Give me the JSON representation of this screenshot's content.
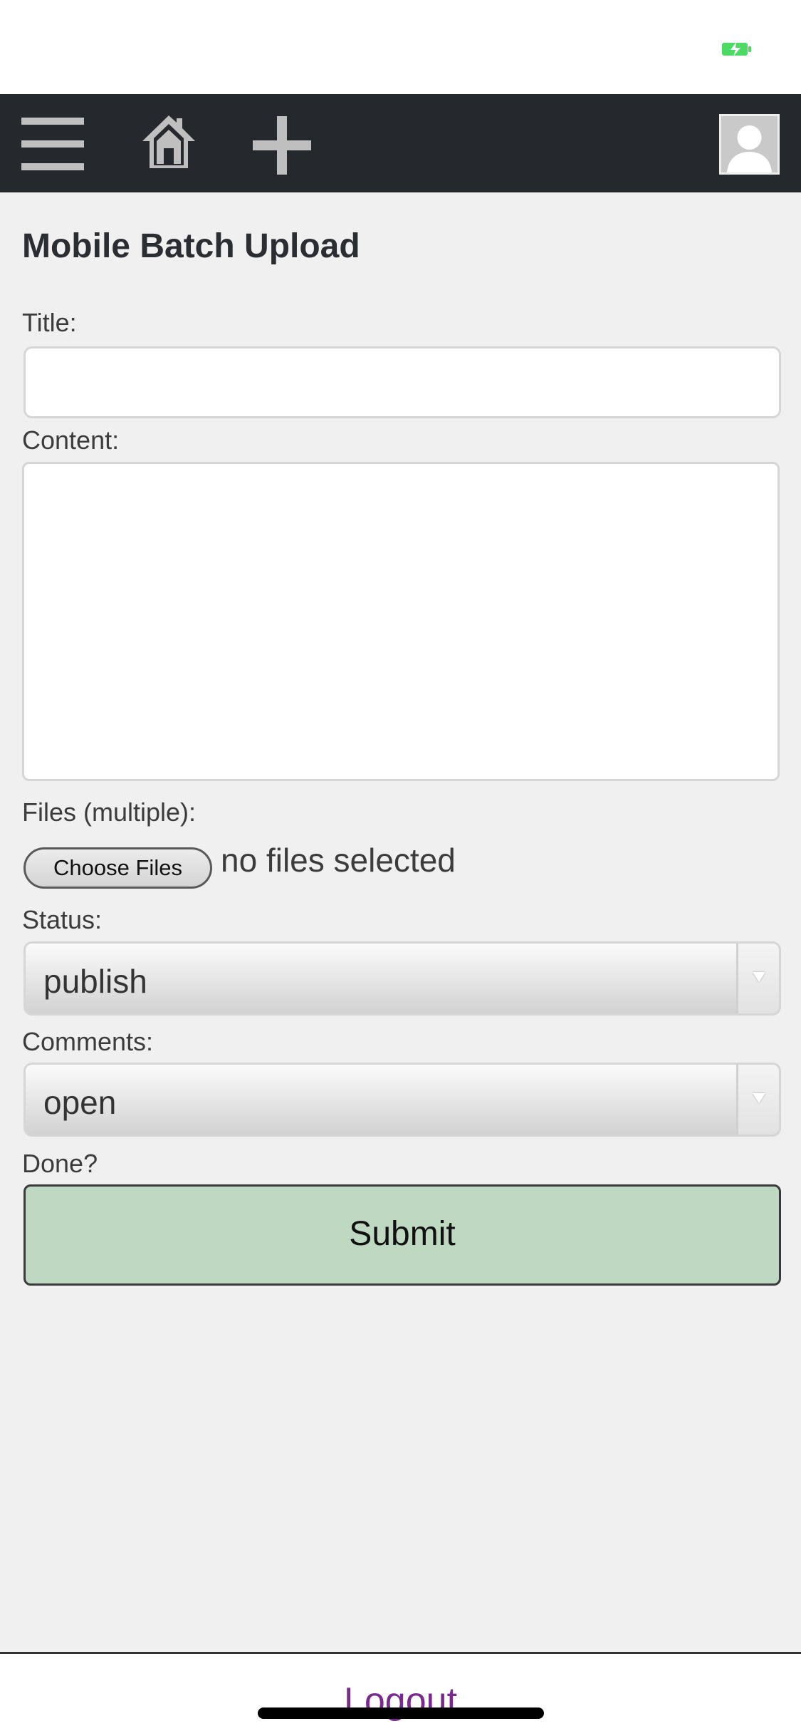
{
  "app": {
    "page_title": "Mobile Batch Upload"
  },
  "navbar": {
    "menu_icon": "hamburger-menu-icon",
    "home_icon": "home-icon",
    "add_icon": "plus-icon",
    "avatar_icon": "user-avatar-icon",
    "background": "#25282d"
  },
  "form": {
    "title_label": "Title:",
    "title_value": "",
    "content_label": "Content:",
    "content_value": "",
    "files_label": "Files (multiple):",
    "choose_files_label": "Choose Files",
    "files_status": "no files selected",
    "status_label": "Status:",
    "status_value": "publish",
    "comments_label": "Comments:",
    "comments_value": "open",
    "done_label": "Done?",
    "submit_label": "Submit"
  },
  "footer": {
    "logout_label": "Logout"
  },
  "colors": {
    "submit_bg": "#bed8c1",
    "logout_link": "#7a2a8c",
    "battery": "#4cd964"
  }
}
